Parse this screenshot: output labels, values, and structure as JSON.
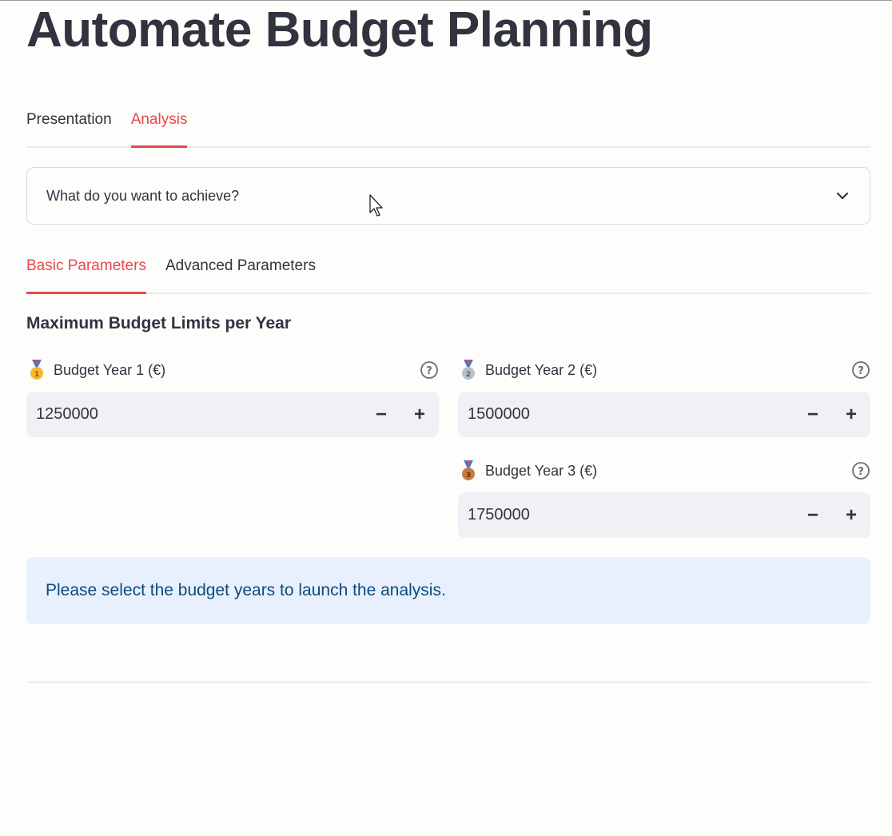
{
  "page": {
    "title": "Automate Budget Planning"
  },
  "main_tabs": [
    {
      "label": "Presentation",
      "active": false
    },
    {
      "label": "Analysis",
      "active": true
    }
  ],
  "expander": {
    "label": "What do you want to achieve?",
    "icon": "chevron-down-icon"
  },
  "param_tabs": [
    {
      "label": "Basic Parameters",
      "active": true
    },
    {
      "label": "Advanced Parameters",
      "active": false
    }
  ],
  "section": {
    "title": "Maximum Budget Limits per Year"
  },
  "fields": [
    {
      "label": "Budget Year 1 (€)",
      "value": "1250000",
      "medal": "gold-medal-icon",
      "medal_color": "#f5b82e"
    },
    {
      "label": "Budget Year 2 (€)",
      "value": "1500000",
      "medal": "silver-medal-icon",
      "medal_color": "#b9c1c8"
    },
    {
      "label": "Budget Year 3 (€)",
      "value": "1750000",
      "medal": "bronze-medal-icon",
      "medal_color": "#c97b42"
    }
  ],
  "stepper": {
    "minus": "−",
    "plus": "+"
  },
  "info": {
    "message": "Please select the budget years to launch the analysis."
  },
  "colors": {
    "accent": "#e9484c",
    "text": "#31333f",
    "info_bg": "#e7f0fc",
    "info_text": "#0e4a7c",
    "input_bg": "#f0f1f5"
  }
}
